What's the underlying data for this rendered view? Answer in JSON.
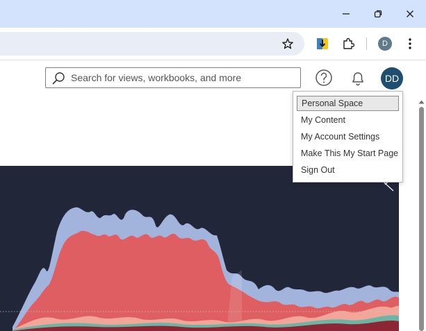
{
  "browser": {
    "window_controls": [
      "minimize-icon",
      "restore-icon",
      "close-icon"
    ],
    "toolbar_icons": [
      "bookmark-star-icon",
      "download-extension-icon",
      "extensions-puzzle-icon",
      "browser-menu-icon"
    ],
    "profile_initial": "D"
  },
  "header": {
    "search_placeholder": "Search for views, workbooks, and more",
    "help_icon": "help-circle-icon",
    "notifications_icon": "bell-icon",
    "avatar_initials": "DD"
  },
  "user_menu": {
    "items": [
      {
        "label": "Personal Space",
        "active": true
      },
      {
        "label": "My Content"
      },
      {
        "label": "My Account Settings"
      },
      {
        "label": "Make This My Start Page"
      },
      {
        "label": "Sign Out"
      }
    ]
  },
  "viz": {
    "background": "#222639",
    "colors": {
      "blue": "#a3b4dc",
      "red": "#df5e61",
      "pink": "#f2a69a",
      "teal": "#6cb5a5",
      "dark_red": "#8c2634"
    }
  }
}
